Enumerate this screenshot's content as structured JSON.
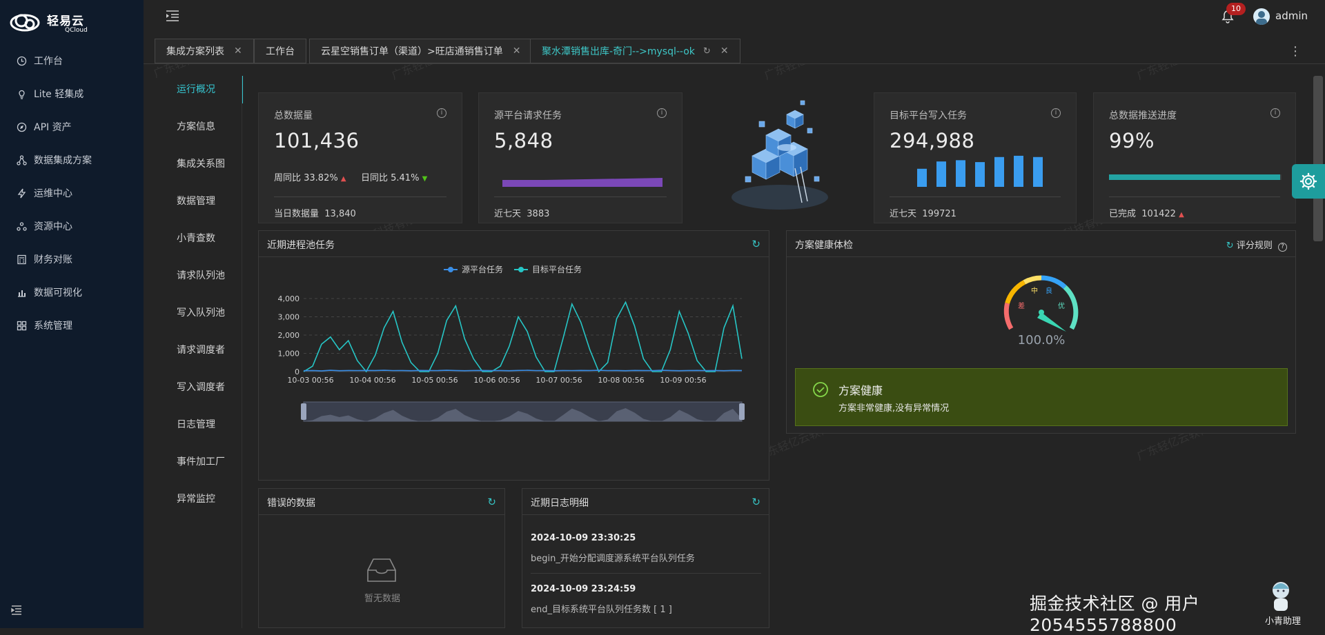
{
  "app": {
    "logo_text": "轻易云",
    "logo_sub": "QCloud"
  },
  "sidebar": {
    "items": [
      {
        "label": "工作台",
        "icon": "clock-icon"
      },
      {
        "label": "Lite 轻集成",
        "icon": "bulb-icon"
      },
      {
        "label": "API 资产",
        "icon": "compass-icon"
      },
      {
        "label": "数据集成方案",
        "icon": "share-icon"
      },
      {
        "label": "运维中心",
        "icon": "bolt-icon"
      },
      {
        "label": "资源中心",
        "icon": "nodes-icon"
      },
      {
        "label": "财务对账",
        "icon": "calculator-icon"
      },
      {
        "label": "数据可视化",
        "icon": "bar-chart-icon"
      },
      {
        "label": "系统管理",
        "icon": "grid-icon"
      }
    ]
  },
  "header": {
    "notifications": "10",
    "user": "admin"
  },
  "tabs": [
    {
      "label": "集成方案列表",
      "closable": true
    },
    {
      "label": "工作台",
      "closable": false
    },
    {
      "label": "云星空销售订单（渠道）>旺店通销售订单",
      "closable": true
    },
    {
      "label": "聚水潭销售出库-奇门-->mysql--ok",
      "closable": true,
      "active": true
    }
  ],
  "subnav": [
    "运行概况",
    "方案信息",
    "集成关系图",
    "数据管理",
    "小青查数",
    "请求队列池",
    "写入队列池",
    "请求调度者",
    "写入调度者",
    "日志管理",
    "事件加工厂",
    "异常监控"
  ],
  "cards": {
    "total": {
      "title": "总数据量",
      "value": "101,436",
      "week_label": "周同比 33.82%",
      "day_label": "日同比 5.41%",
      "foot_label": "当日数据量",
      "foot_value": "13,840"
    },
    "source": {
      "title": "源平台请求任务",
      "value": "5,848",
      "foot_label": "近七天",
      "foot_value": "3883"
    },
    "target": {
      "title": "目标平台写入任务",
      "value": "294,988",
      "foot_label": "近七天",
      "foot_value": "199721",
      "bars": [
        0.57,
        0.8,
        0.84,
        0.78,
        0.94,
        0.98,
        0.94
      ]
    },
    "progress": {
      "title": "总数据推送进度",
      "value": "99%",
      "percent": 99,
      "foot_label": "已完成",
      "foot_value": "101422"
    }
  },
  "chart_panel": {
    "title": "近期进程池任务",
    "chart_data": {
      "type": "line",
      "x_ticks": [
        "10-03 00:56",
        "10-04 00:56",
        "10-05 00:56",
        "10-06 00:56",
        "10-07 00:56",
        "10-08 00:56",
        "10-09 00:56"
      ],
      "ylim": [
        0,
        4000
      ],
      "y_ticks": [
        "0",
        "1,000",
        "2,000",
        "3,000",
        "4,000"
      ],
      "series": [
        {
          "name": "源平台任务",
          "color": "#3a8ee6",
          "values": [
            50,
            60,
            40,
            70,
            50,
            60,
            55,
            65,
            60,
            70,
            55,
            60,
            50,
            65,
            60,
            55,
            70,
            60,
            50,
            60,
            65,
            55,
            60,
            50,
            65,
            70,
            55,
            60,
            50,
            60,
            55,
            65,
            60,
            70,
            55,
            60,
            50,
            65,
            60,
            55,
            70,
            60,
            50,
            60,
            65,
            55,
            60,
            50,
            65,
            60
          ]
        },
        {
          "name": "目标平台任务",
          "color": "#26c6c6",
          "values": [
            0,
            300,
            1500,
            1900,
            1200,
            1700,
            600,
            0,
            900,
            2400,
            3300,
            1600,
            500,
            0,
            0,
            1000,
            2800,
            3600,
            1800,
            700,
            0,
            0,
            300,
            1400,
            3000,
            2200,
            800,
            0,
            0,
            1800,
            3700,
            2700,
            1200,
            0,
            500,
            2900,
            3800,
            2500,
            700,
            0,
            0,
            1200,
            3300,
            2100,
            600,
            0,
            0,
            2400,
            3600,
            700
          ]
        }
      ]
    }
  },
  "health_panel": {
    "title": "方案健康体检",
    "rule_label": "评分规则",
    "gauge": {
      "value": "100.0%",
      "percent": 100,
      "labels": [
        "差",
        "中",
        "良",
        "优"
      ]
    },
    "status_title": "方案健康",
    "status_desc": "方案非常健康,没有异常情况"
  },
  "error_panel": {
    "title": "错误的数据",
    "empty_text": "暂无数据"
  },
  "log_panel": {
    "title": "近期日志明细",
    "entries": [
      {
        "time": "2024-10-09 23:30:25",
        "text": "begin_开始分配调度源系统平台队列任务"
      },
      {
        "time": "2024-10-09 23:24:59",
        "text": "end_目标系统平台队列任务数 [ 1 ]"
      }
    ]
  },
  "assistant": {
    "label": "小青助理"
  },
  "watermark": "掘金技术社区 @ 用户2054555788800",
  "bg_watermark": "广东轻亿云软件科技有限公司"
}
